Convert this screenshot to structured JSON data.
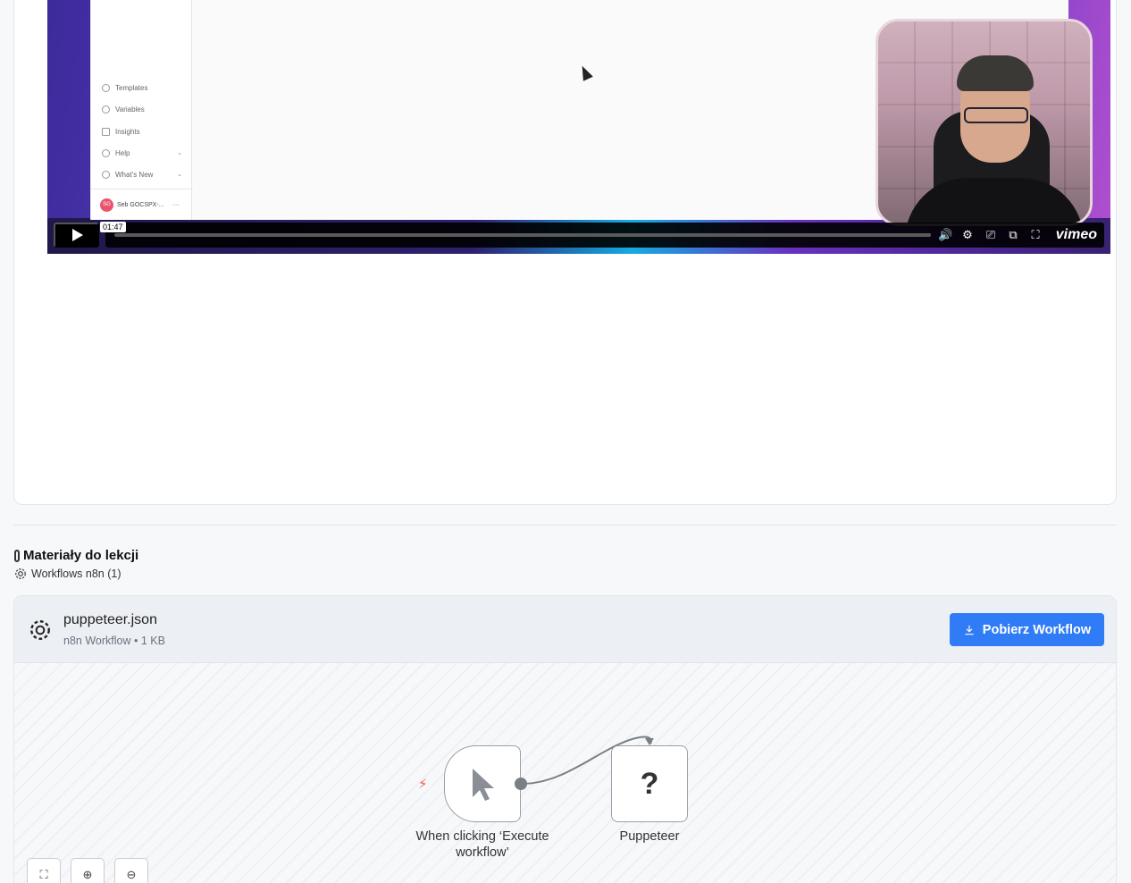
{
  "video": {
    "sidebar_items": [
      {
        "label": "Templates",
        "icon": "templates-icon"
      },
      {
        "label": "Variables",
        "icon": "variables-icon"
      },
      {
        "label": "Insights",
        "icon": "insights-icon"
      },
      {
        "label": "Help",
        "icon": "help-icon"
      },
      {
        "label": "What's New",
        "icon": "bell-icon"
      }
    ],
    "user_name": "Seb GOCSPX-...",
    "user_initials": "SG",
    "timestamp": "01:47",
    "brand": "vimeo",
    "progress": 0.0
  },
  "materials": {
    "title": "Materiały do lekcji",
    "subtitle": "Workflows n8n (1)"
  },
  "workflow": {
    "file_name": "puppeteer.json",
    "meta": "n8n Workflow • 1 KB",
    "download_label": "Pobierz Workflow",
    "accent": "#2f7cf6",
    "nodes": [
      {
        "label": "When clicking ‘Execute workflow’"
      },
      {
        "label": "Puppeteer",
        "glyph": "?"
      }
    ]
  }
}
